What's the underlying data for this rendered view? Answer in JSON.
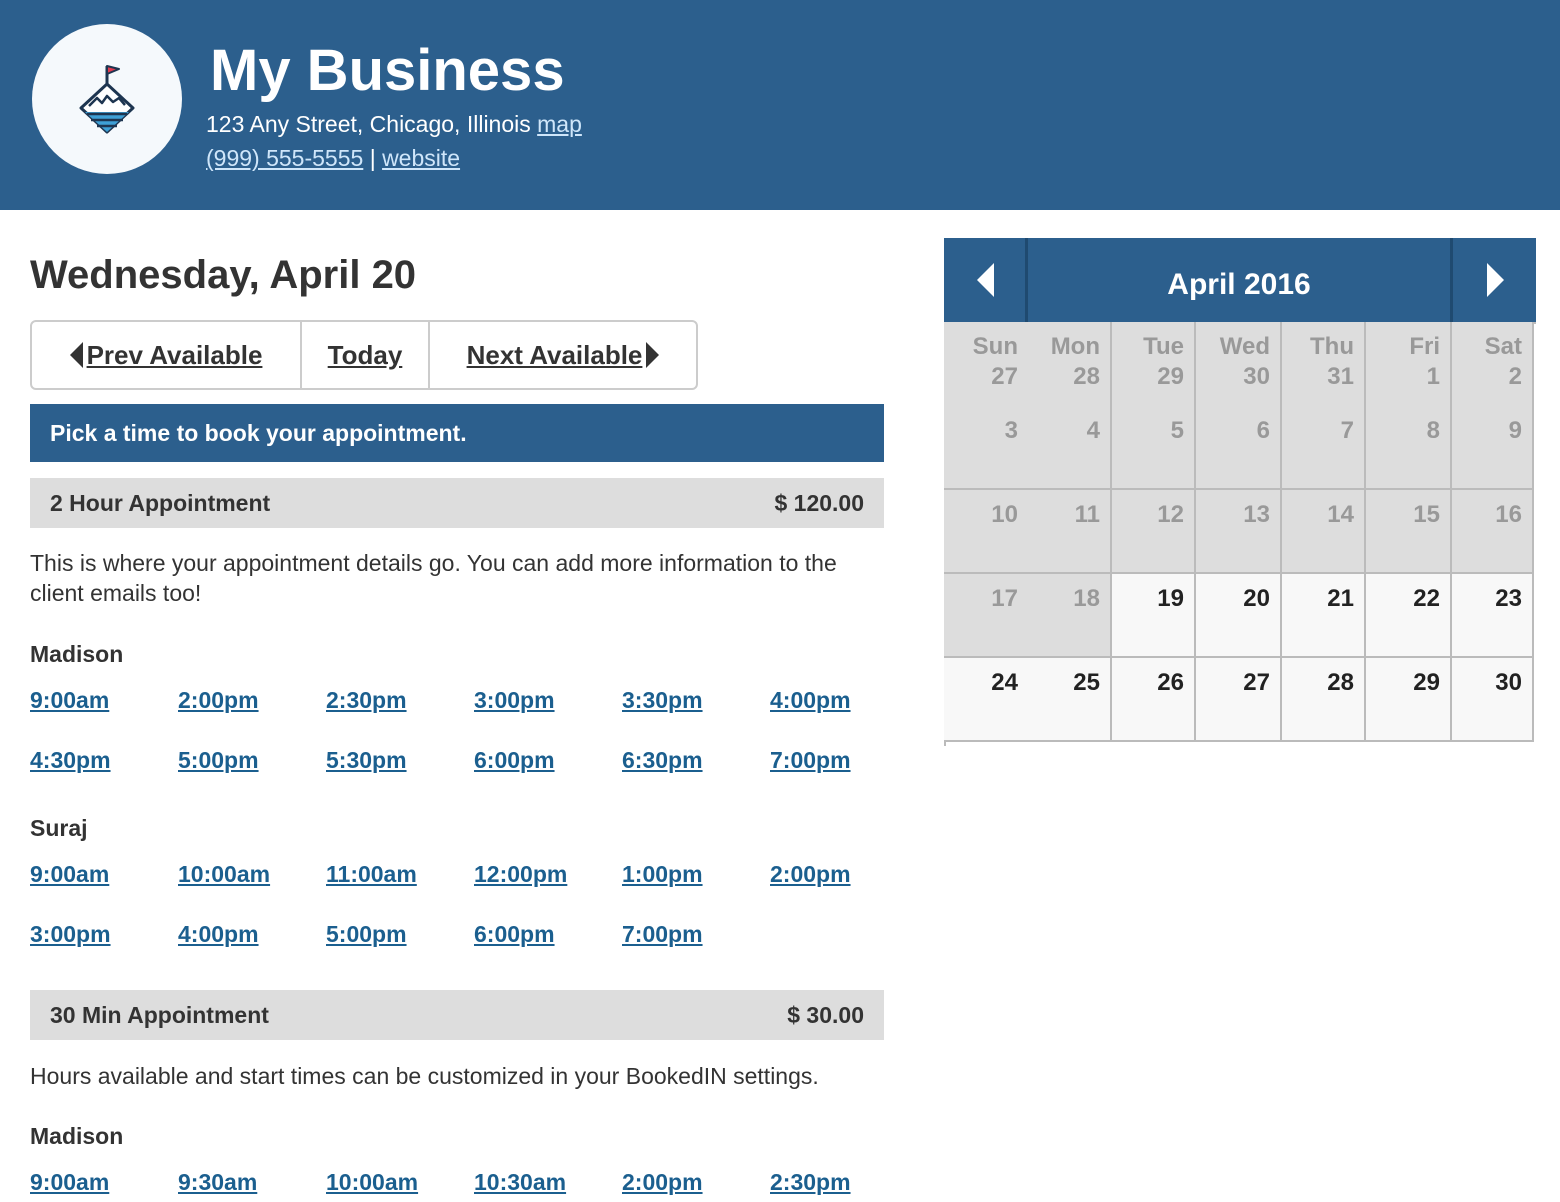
{
  "business": {
    "name": "My Business",
    "address": "123 Any Street, Chicago, Illinois",
    "map_label": "map",
    "phone": "(999) 555-5555",
    "separator": "|",
    "website_label": "website"
  },
  "day_title": "Wednesday, April 20",
  "nav": {
    "prev": "Prev Available",
    "today": "Today",
    "next": "Next Available"
  },
  "pick_message": "Pick a time to book your appointment.",
  "appointments": [
    {
      "name": "2 Hour Appointment",
      "price": "$ 120.00",
      "description": "This is where your appointment details go. You can add more information to the client emails too!",
      "staff": [
        {
          "name": "Madison",
          "times": [
            "9:00am",
            "2:00pm",
            "2:30pm",
            "3:00pm",
            "3:30pm",
            "4:00pm",
            "4:30pm",
            "5:00pm",
            "5:30pm",
            "6:00pm",
            "6:30pm",
            "7:00pm"
          ]
        },
        {
          "name": "Suraj",
          "times": [
            "9:00am",
            "10:00am",
            "11:00am",
            "12:00pm",
            "1:00pm",
            "2:00pm",
            "3:00pm",
            "4:00pm",
            "5:00pm",
            "6:00pm",
            "7:00pm"
          ]
        }
      ]
    },
    {
      "name": "30 Min Appointment",
      "price": "$ 30.00",
      "description": "Hours available and start times can be customized in your BookedIN settings.",
      "staff": [
        {
          "name": "Madison",
          "times": [
            "9:00am",
            "9:30am",
            "10:00am",
            "10:30am",
            "2:00pm",
            "2:30pm"
          ]
        }
      ]
    }
  ],
  "calendar": {
    "title": "April 2016",
    "prev_icon": "caret-left-icon",
    "next_icon": "caret-right-icon",
    "weekdays": [
      "Sun",
      "Mon",
      "Tue",
      "Wed",
      "Thu",
      "Fri",
      "Sat"
    ],
    "weeks": [
      [
        "27",
        "28",
        "29",
        "30",
        "31",
        "1",
        "2"
      ],
      [
        "3",
        "4",
        "5",
        "6",
        "7",
        "8",
        "9"
      ],
      [
        "10",
        "11",
        "12",
        "13",
        "14",
        "15",
        "16"
      ],
      [
        "17",
        "18",
        "19",
        "20",
        "21",
        "22",
        "23"
      ],
      [
        "24",
        "25",
        "26",
        "27",
        "28",
        "29",
        "30"
      ]
    ],
    "first_available_index": 23
  },
  "colors": {
    "brand": "#2c5f8d",
    "slot_link": "#1b5f8f",
    "past_day_bg": "#dddddd",
    "available_day_bg": "#f8f8f8"
  }
}
